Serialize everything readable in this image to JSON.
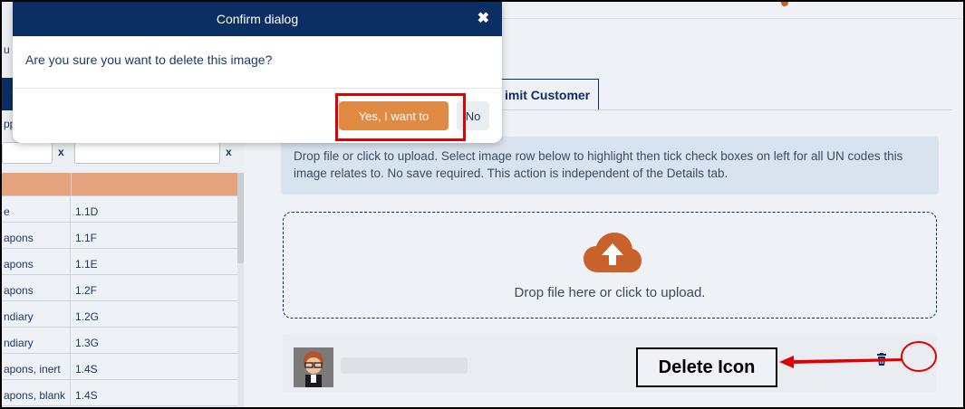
{
  "colors": {
    "navy": "#0b2e63",
    "accent": "#e08a43",
    "highlight_red": "#e00000"
  },
  "left_panel": {
    "cut_text_top": "u",
    "cut_text_side": "pp",
    "filter_clear_1": "x",
    "filter_clear_2": "x",
    "rows": [
      {
        "c1": "e",
        "c2": "1.1D"
      },
      {
        "c1": "apons",
        "c2": "1.1F"
      },
      {
        "c1": "apons",
        "c2": "1.1E"
      },
      {
        "c1": "apons",
        "c2": "1.2F"
      },
      {
        "c1": "ndiary",
        "c2": "1.2G"
      },
      {
        "c1": "ndiary",
        "c2": "1.3G"
      },
      {
        "c1": "apons, inert",
        "c2": "1.4S"
      },
      {
        "c1": "apons, blank",
        "c2": "1.4S"
      }
    ]
  },
  "main": {
    "tab_label": "imit Customer",
    "info_text": "Drop file or click to upload. Select image row below to highlight then tick check boxes on left for all UN codes this image relates to. No save required. This action is independent of the Details tab.",
    "dropzone_text": "Drop file here or click to upload.",
    "callout_label": "Delete Icon",
    "icons": {
      "upload": "cloud-upload-icon",
      "delete": "trash-icon"
    }
  },
  "dialog": {
    "title": "Confirm dialog",
    "close_symbol": "✖",
    "message": "Are you sure you want to delete this image?",
    "yes_label": "Yes, I want to",
    "no_label": "No"
  }
}
